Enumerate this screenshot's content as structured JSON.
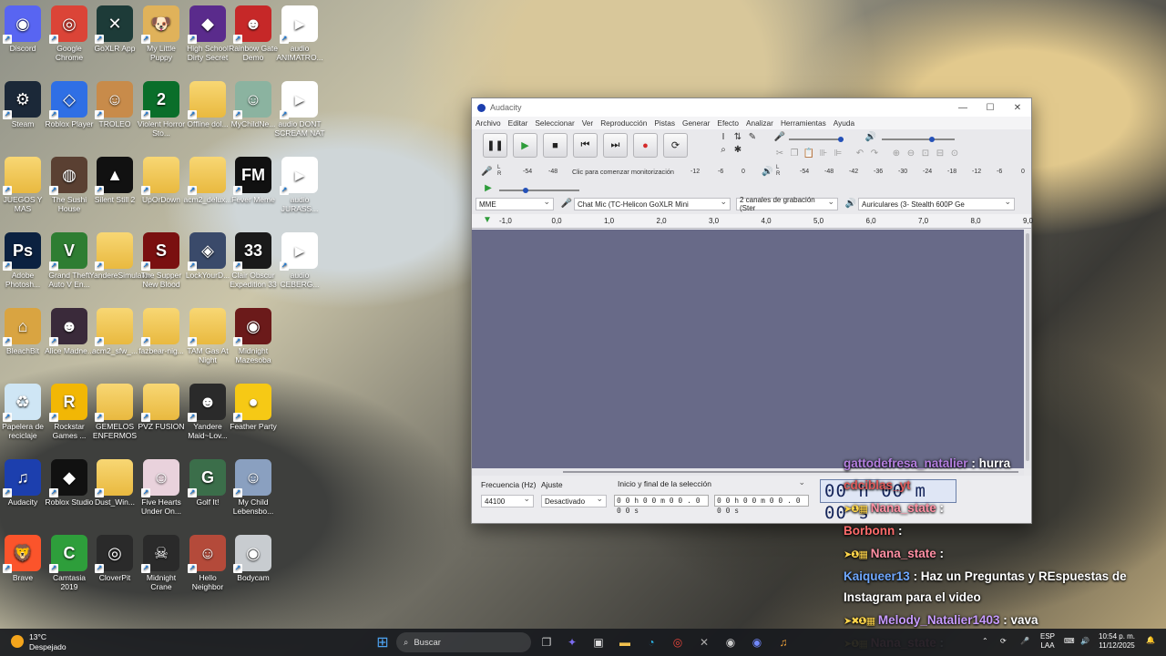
{
  "desktop": {
    "icons": [
      {
        "label": "Discord",
        "col": 0,
        "row": 0,
        "color": "#5865f2",
        "glyph": "◉",
        "icon": "discord-icon"
      },
      {
        "label": "Google Chrome",
        "col": 1,
        "row": 0,
        "color": "#db4437",
        "glyph": "◎",
        "icon": "chrome-icon"
      },
      {
        "label": "GoXLR App",
        "col": 2,
        "row": 0,
        "color": "#1d3b38",
        "glyph": "✕",
        "icon": "goxlr-icon"
      },
      {
        "label": "My Little Puppy",
        "col": 3,
        "row": 0,
        "color": "#e0b25a",
        "glyph": "🐶",
        "icon": "puppy-game-icon"
      },
      {
        "label": "High School Dirty Secret",
        "col": 4,
        "row": 0,
        "color": "#5a2b8c",
        "glyph": "◆",
        "icon": "game-icon"
      },
      {
        "label": "Rainbow Gate Demo",
        "col": 5,
        "row": 0,
        "color": "#c62828",
        "glyph": "☻",
        "icon": "game-icon"
      },
      {
        "label": "audio ANIMATRO...",
        "col": 6,
        "row": 0,
        "color": "#ffffff",
        "glyph": "",
        "icon": "audio-file-icon",
        "audio": true
      },
      {
        "label": "Steam",
        "col": 0,
        "row": 1,
        "color": "#1b2838",
        "glyph": "⚙",
        "icon": "steam-icon"
      },
      {
        "label": "Roblox Player",
        "col": 1,
        "row": 1,
        "color": "#2f6fe5",
        "glyph": "◇",
        "icon": "roblox-icon"
      },
      {
        "label": "TROLEO",
        "col": 2,
        "row": 1,
        "color": "#c88b4a",
        "glyph": "☺",
        "icon": "game-icon"
      },
      {
        "label": "Violent Horror Sto...",
        "col": 3,
        "row": 1,
        "color": "#0a6e2a",
        "glyph": "2",
        "icon": "game-icon"
      },
      {
        "label": "Offline dol...",
        "col": 4,
        "row": 1,
        "color": "#f0c24b",
        "glyph": "",
        "icon": "folder-icon",
        "folder": true
      },
      {
        "label": "MyChildNe...",
        "col": 5,
        "row": 1,
        "color": "#8bb3a0",
        "glyph": "☺",
        "icon": "game-icon"
      },
      {
        "label": "audio DONT SCREAM NAT",
        "col": 6,
        "row": 1,
        "color": "#ffffff",
        "glyph": "",
        "icon": "audio-file-icon",
        "audio": true
      },
      {
        "label": "JUEGOS Y MAS",
        "col": 0,
        "row": 2,
        "color": "#f0c24b",
        "glyph": "",
        "icon": "folder-icon",
        "folder": true
      },
      {
        "label": "The Sushi House",
        "col": 1,
        "row": 2,
        "color": "#5a4032",
        "glyph": "◍",
        "icon": "game-icon"
      },
      {
        "label": "Silent Still 2",
        "col": 2,
        "row": 2,
        "color": "#111111",
        "glyph": "▲",
        "icon": "game-icon"
      },
      {
        "label": "UpOrDown",
        "col": 3,
        "row": 2,
        "color": "#f0c24b",
        "glyph": "",
        "icon": "folder-icon",
        "folder": true
      },
      {
        "label": "acm2_delux...",
        "col": 4,
        "row": 2,
        "color": "#f0c24b",
        "glyph": "",
        "icon": "folder-icon",
        "folder": true
      },
      {
        "label": "Fever Meme",
        "col": 5,
        "row": 2,
        "color": "#111111",
        "glyph": "FM",
        "icon": "game-icon"
      },
      {
        "label": "audio JURASS...",
        "col": 6,
        "row": 2,
        "color": "#ffffff",
        "glyph": "",
        "icon": "audio-file-icon",
        "audio": true
      },
      {
        "label": "Adobe Photosh...",
        "col": 0,
        "row": 3,
        "color": "#0b2140",
        "glyph": "Ps",
        "icon": "photoshop-icon"
      },
      {
        "label": "Grand Theft Auto V En...",
        "col": 1,
        "row": 3,
        "color": "#2e7d32",
        "glyph": "V",
        "icon": "gta-icon"
      },
      {
        "label": "YandereSimulator",
        "col": 2,
        "row": 3,
        "color": "#f0c24b",
        "glyph": "",
        "icon": "folder-icon",
        "folder": true
      },
      {
        "label": "The Supper New Blood",
        "col": 3,
        "row": 3,
        "color": "#7a1010",
        "glyph": "S",
        "icon": "game-icon"
      },
      {
        "label": "LockYourD...",
        "col": 4,
        "row": 3,
        "color": "#3a4a6a",
        "glyph": "◈",
        "icon": "game-icon"
      },
      {
        "label": "Clair Obscur Expedition 33",
        "col": 5,
        "row": 3,
        "color": "#1a1a1a",
        "glyph": "33",
        "icon": "game-icon"
      },
      {
        "label": "audio CEBERG...",
        "col": 6,
        "row": 3,
        "color": "#ffffff",
        "glyph": "",
        "icon": "audio-file-icon",
        "audio": true
      },
      {
        "label": "BleachBit",
        "col": 0,
        "row": 4,
        "color": "#d9a441",
        "glyph": "⌂",
        "icon": "bleachbit-icon"
      },
      {
        "label": "Alice Madne...",
        "col": 1,
        "row": 4,
        "color": "#3a2a3a",
        "glyph": "☻",
        "icon": "game-icon"
      },
      {
        "label": "acm2_sfw_...",
        "col": 2,
        "row": 4,
        "color": "#f0c24b",
        "glyph": "",
        "icon": "folder-icon",
        "folder": true
      },
      {
        "label": "fazbear-nig...",
        "col": 3,
        "row": 4,
        "color": "#f0c24b",
        "glyph": "",
        "icon": "folder-icon",
        "folder": true
      },
      {
        "label": "TAM Gas At Night",
        "col": 4,
        "row": 4,
        "color": "#f0c24b",
        "glyph": "",
        "icon": "folder-icon",
        "folder": true
      },
      {
        "label": "Midnight Mazesoba",
        "col": 5,
        "row": 4,
        "color": "#6b1a1a",
        "glyph": "◉",
        "icon": "game-icon"
      },
      {
        "label": "Papelera de reciclaje",
        "col": 0,
        "row": 5,
        "color": "#cfe6f5",
        "glyph": "♻",
        "icon": "recycle-bin-icon"
      },
      {
        "label": "Rockstar Games ...",
        "col": 1,
        "row": 5,
        "color": "#f2b705",
        "glyph": "R",
        "icon": "rockstar-icon"
      },
      {
        "label": "GEMELOS ENFERMOS",
        "col": 2,
        "row": 5,
        "color": "#f0c24b",
        "glyph": "",
        "icon": "folder-icon",
        "folder": true
      },
      {
        "label": "PVZ FUSION",
        "col": 3,
        "row": 5,
        "color": "#f0c24b",
        "glyph": "",
        "icon": "folder-icon",
        "folder": true
      },
      {
        "label": "Yandere Maid~Lov...",
        "col": 4,
        "row": 5,
        "color": "#2a2a2a",
        "glyph": "☻",
        "icon": "game-icon"
      },
      {
        "label": "Feather Party",
        "col": 5,
        "row": 5,
        "color": "#f6c915",
        "glyph": "●",
        "icon": "game-icon"
      },
      {
        "label": "Audacity",
        "col": 0,
        "row": 6,
        "color": "#1c3fae",
        "glyph": "♫",
        "icon": "audacity-icon"
      },
      {
        "label": "Roblox Studio",
        "col": 1,
        "row": 6,
        "color": "#111111",
        "glyph": "◆",
        "icon": "roblox-studio-icon"
      },
      {
        "label": "Dust_Win...",
        "col": 2,
        "row": 6,
        "color": "#f0c24b",
        "glyph": "",
        "icon": "folder-icon",
        "folder": true
      },
      {
        "label": "Five Hearts Under On...",
        "col": 3,
        "row": 6,
        "color": "#e9d2dc",
        "glyph": "☺",
        "icon": "game-icon"
      },
      {
        "label": "Golf It!",
        "col": 4,
        "row": 6,
        "color": "#3b6e4a",
        "glyph": "G",
        "icon": "game-icon"
      },
      {
        "label": "My Child Lebensbo...",
        "col": 5,
        "row": 6,
        "color": "#8aa0c0",
        "glyph": "☺",
        "icon": "game-icon"
      },
      {
        "label": "Brave",
        "col": 0,
        "row": 7,
        "color": "#fb542b",
        "glyph": "🦁",
        "icon": "brave-icon"
      },
      {
        "label": "Camtasia 2019",
        "col": 1,
        "row": 7,
        "color": "#2e9e3b",
        "glyph": "C",
        "icon": "camtasia-icon"
      },
      {
        "label": "CloverPit",
        "col": 2,
        "row": 7,
        "color": "#2a2a2a",
        "glyph": "◎",
        "icon": "game-icon"
      },
      {
        "label": "Midnight Crane",
        "col": 3,
        "row": 7,
        "color": "#2a2a2a",
        "glyph": "☠",
        "icon": "game-icon"
      },
      {
        "label": "Hello Neighbor",
        "col": 4,
        "row": 7,
        "color": "#b44a3a",
        "glyph": "☺",
        "icon": "game-icon"
      },
      {
        "label": "Bodycam",
        "col": 5,
        "row": 7,
        "color": "#c8ccd0",
        "glyph": "◉",
        "icon": "game-icon"
      }
    ]
  },
  "audacity": {
    "title": "Audacity",
    "menu": [
      "Archivo",
      "Editar",
      "Seleccionar",
      "Ver",
      "Reproducción",
      "Pistas",
      "Generar",
      "Efecto",
      "Analizar",
      "Herramientas",
      "Ayuda"
    ],
    "record_meter_ticks": [
      "-54",
      "-48",
      "-12",
      "-6",
      "0"
    ],
    "record_meter_text": "Clic para comenzar monitorización",
    "play_meter_ticks": [
      "-54",
      "-48",
      "-42",
      "-36",
      "-30",
      "-24",
      "-18",
      "-12",
      "-6",
      "0"
    ],
    "meter_lr": [
      "L",
      "R"
    ],
    "host": "MME",
    "recording_device": "Chat Mic (TC-Helicon GoXLR Mini",
    "channels": "2 canales de grabación (Ster",
    "playback_device": "Auriculares (3- Stealth 600P Ge",
    "ruler_ticks": [
      "-1,0",
      "0,0",
      "1,0",
      "2,0",
      "3,0",
      "4,0",
      "5,0",
      "6,0",
      "7,0",
      "8,0",
      "9,0"
    ],
    "rate_label": "Frecuencia (Hz)",
    "rate_value": "44100",
    "snap_label": "Ajuste",
    "snap_value": "Desactivado",
    "selection_label": "Inicio y final de la selección",
    "sel_start": "0 0 h 0 0 m 0 0 . 0 0 0 s",
    "sel_end": "0 0 h 0 0 m 0 0 . 0 0 0 s",
    "big_time": "00 h 00 m 00 s",
    "win_min": "—",
    "win_max": "☐",
    "win_close": "✕"
  },
  "chat": [
    {
      "user": "gattodefresa_natalier",
      "msg": ": hurra",
      "color": "#b57fe0",
      "badges": ""
    },
    {
      "user": "cdciblas_yt",
      "msg": "",
      "color": "#e05a5a",
      "badges": ""
    },
    {
      "user": "Nana_state",
      "msg": ":",
      "color": "#ff8fa3",
      "badges": "➤❶▦"
    },
    {
      "user": "Borbonn",
      "msg": ":",
      "color": "#ff6b6b",
      "badges": ""
    },
    {
      "user": "Nana_state",
      "msg": ":",
      "color": "#ff8fa3",
      "badges": "➤❶▦"
    },
    {
      "user": "Kaiqueer13",
      "msg": ": Haz un Preguntas y REspuestas de",
      "color": "#6fa8ff",
      "badges": ""
    },
    {
      "user": "",
      "msg": "Instagram para el video",
      "color": "#ffffff",
      "badges": ""
    },
    {
      "user": "Melody_Natalier1403",
      "msg": ": vava",
      "color": "#c79bff",
      "badges": "➤✖❶▦"
    },
    {
      "user": "Nana_state",
      "msg": ":",
      "color": "#ff8fa3",
      "badges": "➤❶▦"
    }
  ],
  "taskbar": {
    "temp": "13°C",
    "weather": "Despejado",
    "search_placeholder": "Buscar",
    "lang_1": "ESP",
    "lang_2": "LAA",
    "time": "10:54 p. m.",
    "date": "11/12/2025"
  }
}
